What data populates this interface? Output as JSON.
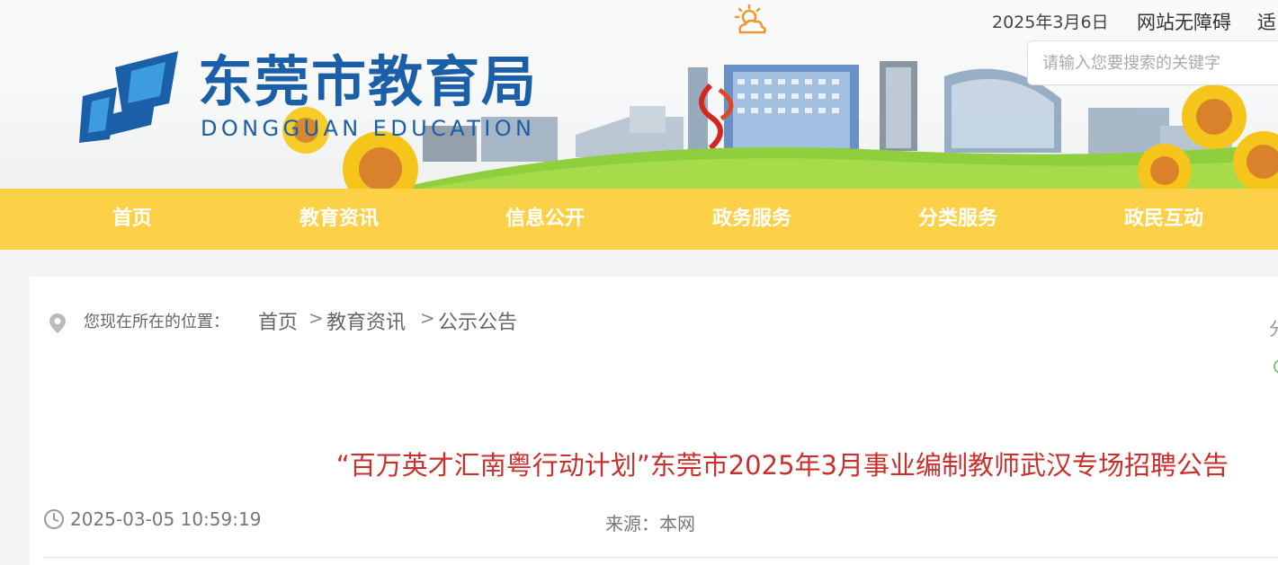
{
  "header": {
    "date": "2025年3月6日",
    "accessibility_label": "网站无障碍",
    "elder_label": "适",
    "search_placeholder": "请输入您要搜索的关键字",
    "site_name": "东莞市教育局",
    "site_name_en": "DONGGUAN EDUCATION",
    "weather_icon": "sun-cloud-icon",
    "brand_color": "#1a5fa8"
  },
  "nav": {
    "background": "#fdd147",
    "items": [
      {
        "label": "首页"
      },
      {
        "label": "教育资讯"
      },
      {
        "label": "信息公开"
      },
      {
        "label": "政务服务"
      },
      {
        "label": "分类服务"
      },
      {
        "label": "政民互动"
      }
    ]
  },
  "breadcrumb": {
    "label": "您现在所在的位置：",
    "items": [
      "首页",
      "教育资讯",
      "公示公告"
    ],
    "separator": ">"
  },
  "side": {
    "partial_text": "分"
  },
  "article": {
    "title": "“百万英才汇南粤行动计划”东莞市2025年3月事业编制教师武汉专场招聘公告",
    "title_color": "#c9302c",
    "publish_time": "2025-03-05 10:59:19",
    "source": "来源：本网"
  }
}
